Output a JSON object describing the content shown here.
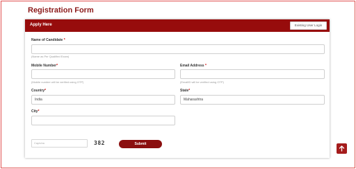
{
  "page": {
    "title": "Registration Form"
  },
  "card": {
    "header_title": "Apply Here",
    "existing_user_button": "Existing User Login"
  },
  "form": {
    "name_label": "Name of Candidate",
    "name_hint": "(Name as Per Qualified Exam)",
    "name_value": "",
    "mobile_label": "Mobile Number",
    "mobile_hint": "(Mobile number will be verified using OTP)",
    "mobile_value": "",
    "email_label": "Email Address",
    "email_hint": "(EmailID will be verified using OTP)",
    "email_value": "",
    "country_label": "Country",
    "country_value": "India",
    "state_label": "State",
    "state_value": "Maharashtra",
    "city_label": "City",
    "city_value": "",
    "required_mark": "*",
    "captcha_placeholder": "Captcha",
    "captcha_code": "382",
    "submit_label": "Submit"
  },
  "icons": {
    "scroll_top": "arrow-up-icon"
  },
  "colors": {
    "brand": "#970c0c",
    "title": "#8b1a1a",
    "required": "#d00000"
  }
}
